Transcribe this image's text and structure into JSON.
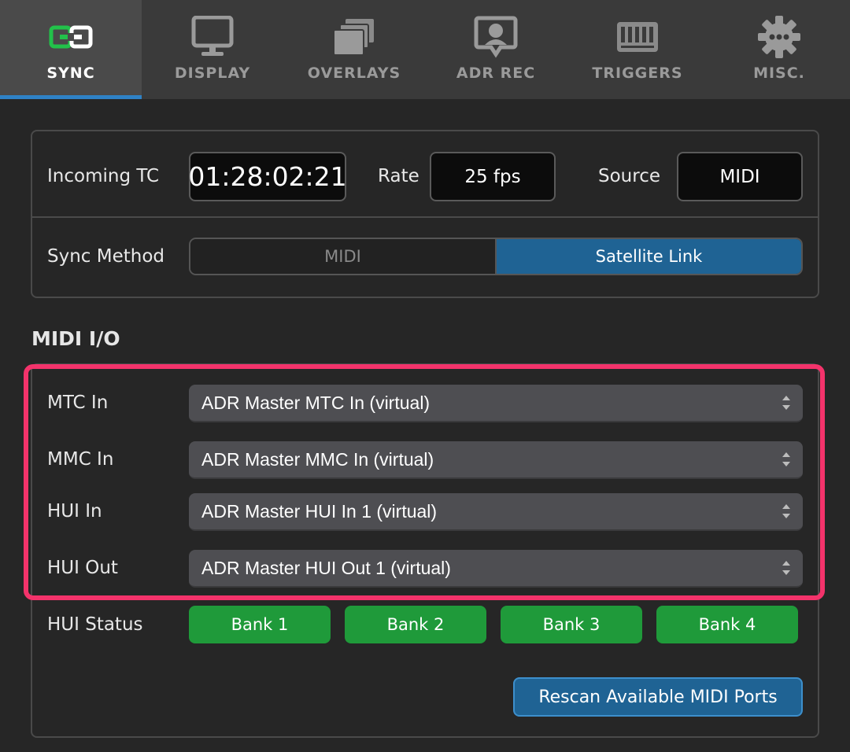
{
  "tabs": [
    {
      "label": "SYNC",
      "icon": "sync-icon",
      "active": true
    },
    {
      "label": "DISPLAY",
      "icon": "monitor-icon",
      "active": false
    },
    {
      "label": "OVERLAYS",
      "icon": "overlays-icon",
      "active": false
    },
    {
      "label": "ADR REC",
      "icon": "adr-rec-icon",
      "active": false
    },
    {
      "label": "TRIGGERS",
      "icon": "midi-icon",
      "active": false
    },
    {
      "label": "MISC.",
      "icon": "gear-icon",
      "active": false
    }
  ],
  "sync": {
    "incoming_tc_label": "Incoming TC",
    "incoming_tc_value": "01:28:02:21",
    "rate_label": "Rate",
    "rate_value": "25 fps",
    "source_label": "Source",
    "source_value": "MIDI",
    "method_label": "Sync Method",
    "method_options": [
      "MIDI",
      "Satellite Link"
    ],
    "method_selected": "Satellite Link"
  },
  "midi_io": {
    "title": "MIDI I/O",
    "ports": [
      {
        "label": "MTC In",
        "value": "ADR Master MTC In (virtual)"
      },
      {
        "label": "MMC In",
        "value": "ADR Master MMC In (virtual)"
      },
      {
        "label": "HUI In",
        "value": "ADR Master HUI In 1 (virtual)"
      },
      {
        "label": "HUI Out",
        "value": "ADR Master HUI Out 1 (virtual)"
      }
    ],
    "hui_status_label": "HUI Status",
    "banks": [
      "Bank 1",
      "Bank 2",
      "Bank 3",
      "Bank 4"
    ],
    "rescan_label": "Rescan Available MIDI Ports"
  },
  "colors": {
    "accent": "#2f82c6",
    "selected_segment": "#1f6394",
    "bank_active": "#1f9a3a",
    "highlight": "#f3336b",
    "sync_icon": "#22c24a"
  }
}
